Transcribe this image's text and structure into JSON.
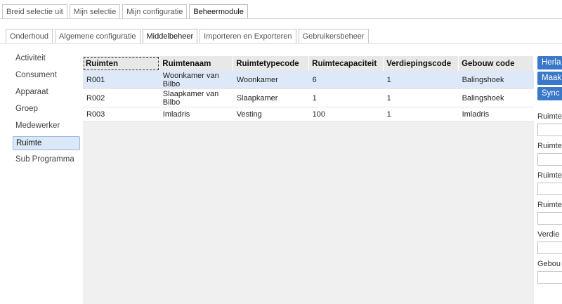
{
  "top_tabs": [
    {
      "label": "Breid selectie uit",
      "active": false
    },
    {
      "label": "Mijn selectie",
      "active": false
    },
    {
      "label": "Mijn configuratie",
      "active": false
    },
    {
      "label": "Beheermodule",
      "active": true
    }
  ],
  "sub_tabs": [
    {
      "label": "Onderhoud",
      "active": false
    },
    {
      "label": "Algemene configuratie",
      "active": false
    },
    {
      "label": "Middelbeheer",
      "active": true
    },
    {
      "label": "Importeren en Exporteren",
      "active": false
    },
    {
      "label": "Gebruikersbeheer",
      "active": false
    }
  ],
  "sidebar": {
    "items": [
      {
        "label": "Activiteit",
        "active": false
      },
      {
        "label": "Consument",
        "active": false
      },
      {
        "label": "Apparaat",
        "active": false
      },
      {
        "label": "Groep",
        "active": false
      },
      {
        "label": "Medewerker",
        "active": false
      },
      {
        "label": "Ruimte",
        "active": true
      },
      {
        "label": "Sub Programma",
        "active": false
      }
    ]
  },
  "table": {
    "columns": [
      "Ruimten",
      "Ruimtenaam",
      "Ruimtetypecode",
      "Ruimtecapaciteit",
      "Verdiepingscode",
      "Gebouw code"
    ],
    "rows": [
      {
        "selected": true,
        "cells": [
          "R001",
          "Woonkamer van Bilbo",
          "Woonkamer",
          "6",
          "1",
          "Balingshoek"
        ]
      },
      {
        "selected": false,
        "cells": [
          "R002",
          "Slaapkamer van Bilbo",
          "Slaapkamer",
          "1",
          "1",
          "Balingshoek"
        ]
      },
      {
        "selected": false,
        "cells": [
          "R003",
          "Imladris",
          "Vesting",
          "100",
          "1",
          "Imladris"
        ]
      }
    ]
  },
  "right_panel": {
    "buttons": [
      "Herla",
      "Maak",
      "Sync"
    ],
    "fields": [
      {
        "label": "Ruimte",
        "value": ""
      },
      {
        "label": "Ruimte",
        "value": ""
      },
      {
        "label": "Ruimte",
        "value": ""
      },
      {
        "label": "Ruimte",
        "value": ""
      },
      {
        "label": "Verdie",
        "value": ""
      },
      {
        "label": "Gebou",
        "value": ""
      }
    ]
  },
  "colors": {
    "accent": "#3a78c9",
    "selected_row": "#dde9f8",
    "header_bg": "#e8e8e8"
  }
}
